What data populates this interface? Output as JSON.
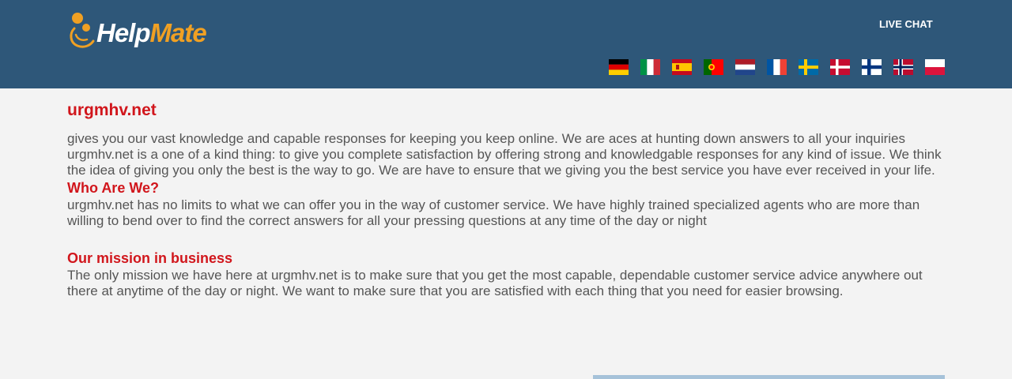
{
  "header": {
    "logo": {
      "part1": "Help",
      "part2": "Mate"
    },
    "live_chat_label": "LIVE CHAT",
    "flags": [
      "german-flag-icon",
      "italian-flag-icon",
      "spanish-flag-icon",
      "portuguese-flag-icon",
      "dutch-flag-icon",
      "french-flag-icon",
      "swedish-flag-icon",
      "danish-flag-icon",
      "finnish-flag-icon",
      "norwegian-flag-icon",
      "polish-flag-icon"
    ]
  },
  "main": {
    "site_title": "urgmhv.net",
    "intro_text": "gives you our vast knowledge and capable responses for keeping you keep online. We are aces at hunting down answers to all your inquiries urgmhv.net is a one of a kind thing: to give you complete satisfaction by offering strong and knowledgable responses for any kind of issue. We think the idea of giving you only the best is the way to go. We are have to ensure that we giving you the best service you have ever received in your life.",
    "sections": [
      {
        "title": "Who Are We?",
        "text": "urgmhv.net has no limits to what we can offer you in the way of customer service. We have highly trained specialized agents who are more than willing to bend over to find the correct answers for all your pressing questions at any time of the day or night"
      },
      {
        "title": "Our mission in business",
        "text": "The only mission we have here at urgmhv.net is to make sure that you get the most capable, dependable customer service advice anywhere out there at anytime of the day or night. We want to make sure that you are satisfied with each thing that you need for easier browsing."
      }
    ]
  },
  "colors": {
    "header_bg": "#2e5779",
    "accent_red": "#d1161c",
    "logo_orange": "#f0a023",
    "page_bg": "#f3f3f3",
    "body_text": "#555555"
  }
}
